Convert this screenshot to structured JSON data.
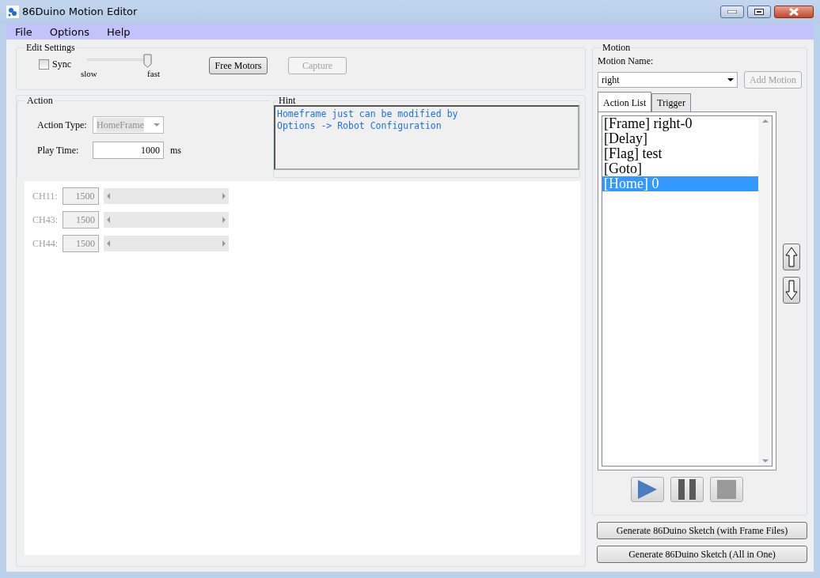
{
  "window": {
    "title": "86Duino Motion Editor"
  },
  "menu": [
    "File",
    "Options",
    "Help"
  ],
  "edit_settings": {
    "title": "Edit Settings",
    "sync": {
      "label": "Sync",
      "checked": false
    },
    "speed": {
      "level": 1.0,
      "min_label": "slow",
      "max_label": "fast"
    },
    "buttons": [
      {
        "label": "Free Motors",
        "disabled": false
      },
      {
        "label": "Capture",
        "disabled": true
      }
    ]
  },
  "action": {
    "title": "Action",
    "action_type": {
      "label": "Action Type:",
      "value": "HomeFrame",
      "disabled": true
    },
    "play_time": {
      "label": "Play Time:",
      "value": "1000",
      "unit": "ms"
    }
  },
  "hint": {
    "title": "Hint",
    "lines": [
      "Homeframe just can be modified by",
      "Options -> Robot Configuration"
    ]
  },
  "channels": [
    {
      "label": "CH11:",
      "value": "1500",
      "disabled": true
    },
    {
      "label": "CH43:",
      "value": "1500",
      "disabled": true
    },
    {
      "label": "CH44:",
      "value": "1500",
      "disabled": true
    }
  ],
  "motion": {
    "title": "Motion",
    "name_label": "Motion Name:",
    "name_value": "right",
    "add_button": {
      "label": "Add Motion",
      "disabled": true
    },
    "tabs": [
      {
        "label": "Action List",
        "selected": true
      },
      {
        "label": "Trigger",
        "selected": false
      }
    ],
    "actions": [
      {
        "text": "[Frame] right-0",
        "selected": false
      },
      {
        "text": "[Delay]",
        "selected": false
      },
      {
        "text": "[Flag] test",
        "selected": false
      },
      {
        "text": "[Goto]",
        "selected": false
      },
      {
        "text": "[Home] 0",
        "selected": true
      }
    ]
  },
  "generate_buttons": [
    "Generate 86Duino Sketch (with Frame Files)",
    "Generate 86Duino Sketch (All in One)"
  ]
}
